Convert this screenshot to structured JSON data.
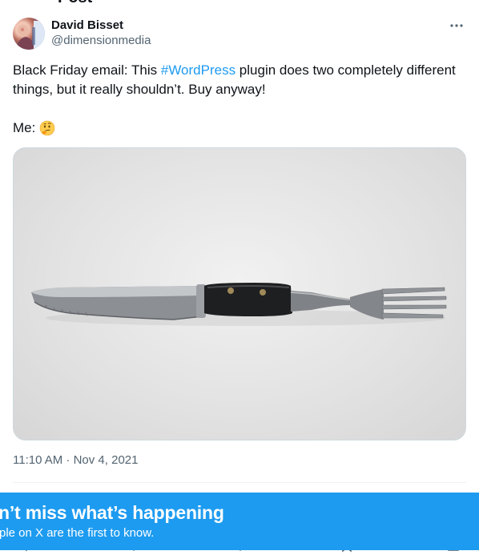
{
  "header": {
    "cut_title": "Post"
  },
  "tweet": {
    "author_name": "David Bisset",
    "author_handle": "@dimensionmedia",
    "text_before": "Black Friday email: This ",
    "hashtag": "#WordPress",
    "text_after": " plugin does two completely different things, but it really shouldn’t. Buy anyway!",
    "me_label": "Me:",
    "me_emoji": "thinking-face",
    "image_alt": "A utensil combining a serrated knife blade and a fork on one handle",
    "timestamp": "11:10 AM · Nov 4, 2021"
  },
  "banner": {
    "title": "n’t miss what’s happening",
    "subtitle": "ple on X are the first to know."
  },
  "colors": {
    "accent": "#1d9bf0",
    "text": "#0f1419",
    "muted": "#536471",
    "border": "#cfd9de"
  },
  "icons": [
    "more-icon",
    "thinking-face-emoji",
    "reply-icon",
    "repost-icon",
    "like-icon",
    "views-icon",
    "bookmark-icon",
    "share-icon"
  ]
}
